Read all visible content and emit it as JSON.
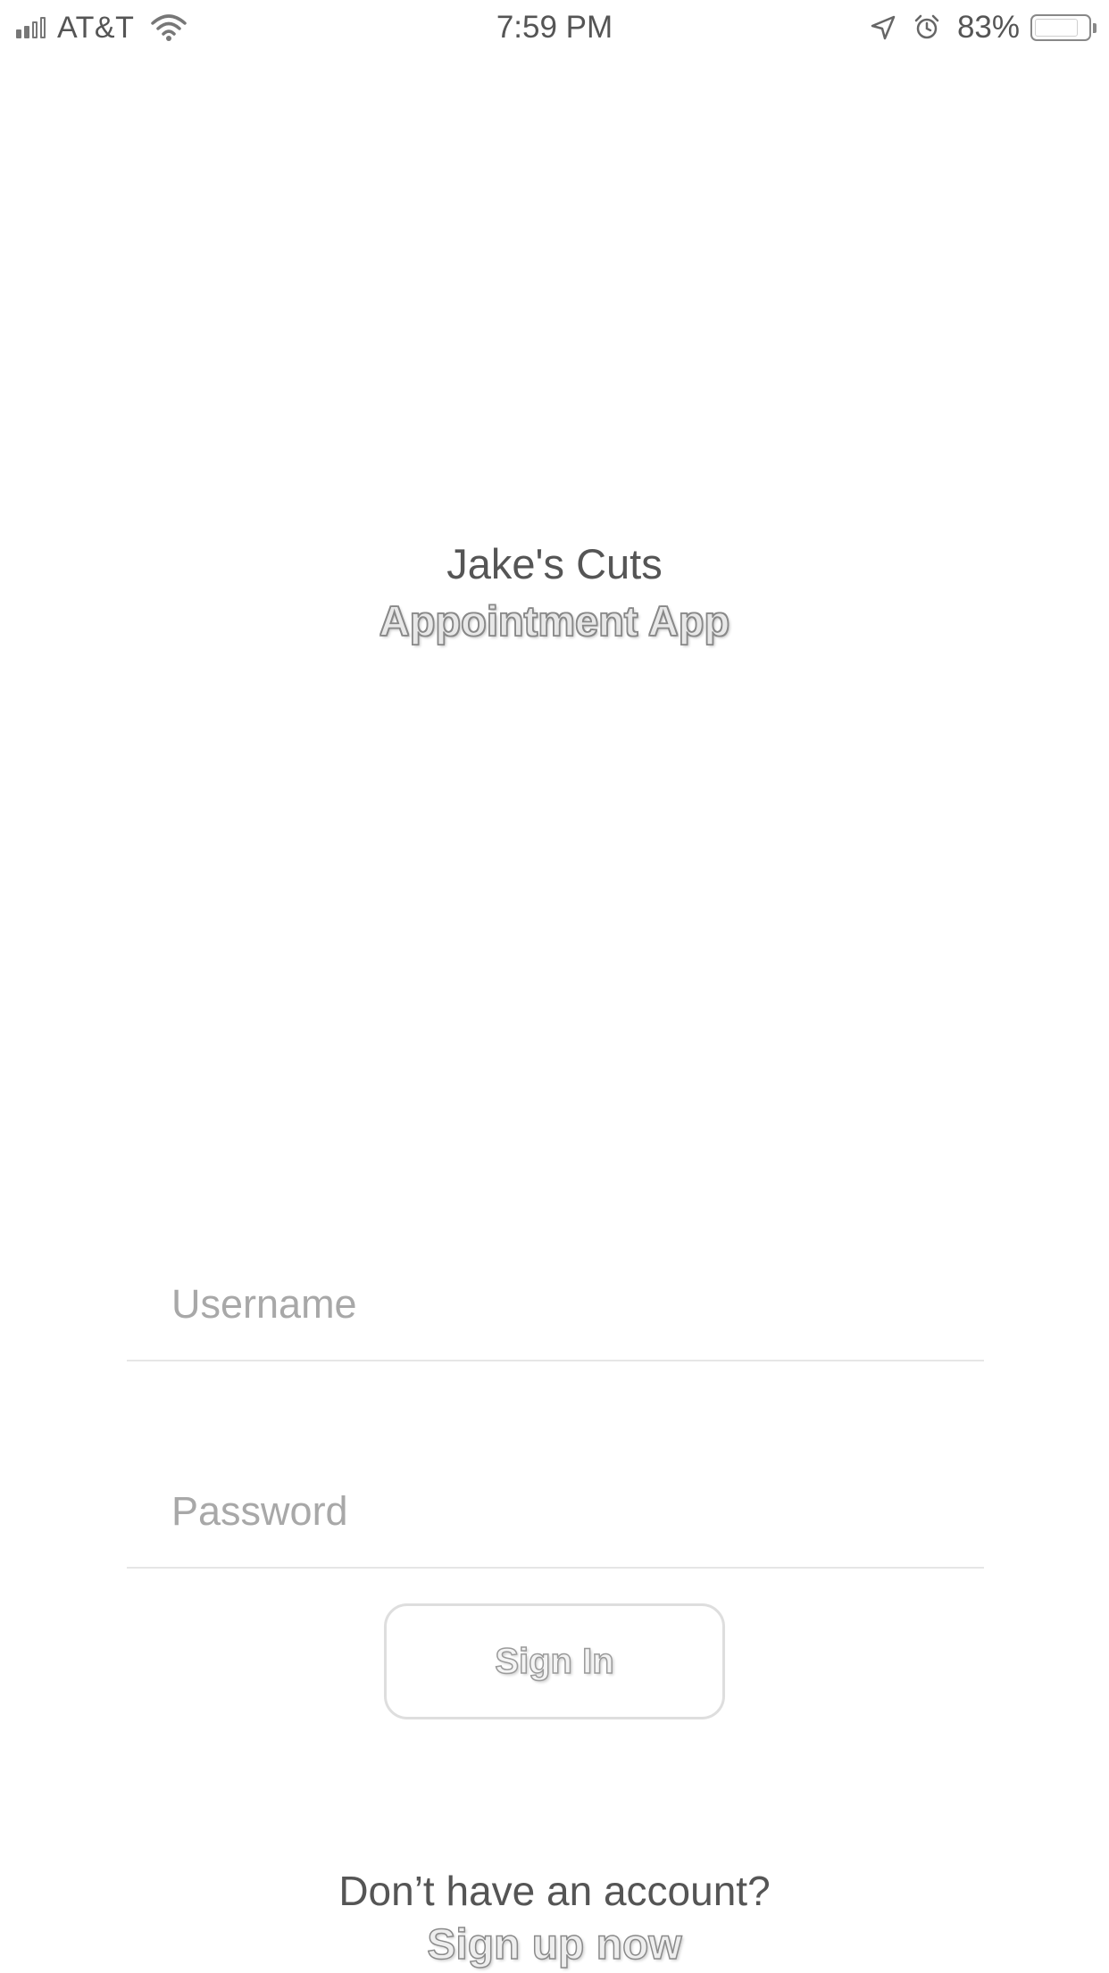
{
  "status_bar": {
    "carrier": "AT&T",
    "time": "7:59 PM",
    "battery_percent_label": "83%",
    "battery_level": 0.83,
    "signal_bars_on": 2,
    "signal_bars_total": 4,
    "icons": [
      "signal-icon",
      "wifi-icon",
      "location-arrow-icon",
      "alarm-clock-icon",
      "battery-icon"
    ]
  },
  "brand": {
    "title": "Jake's Cuts",
    "subtitle": "Appointment App"
  },
  "form": {
    "username_placeholder": "Username",
    "username_value": "",
    "password_placeholder": "Password",
    "password_value": "",
    "signin_label": "Sign In"
  },
  "footer": {
    "question": "Don’t have an account?",
    "signup_label": "Sign up now"
  },
  "colors": {
    "background": "#ffffff",
    "text": "#555555",
    "placeholder": "#a8a8a8",
    "divider": "#e6e6e6"
  }
}
